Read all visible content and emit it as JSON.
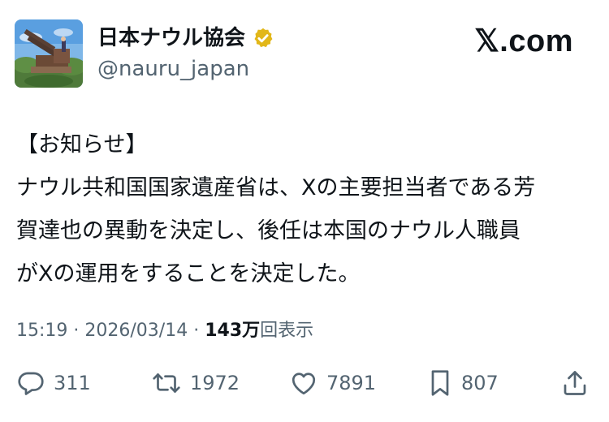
{
  "account": {
    "display_name": "日本ナウル協会",
    "handle": "@nauru_japan",
    "verified_icon": "verified-badge-icon",
    "verified_color": "#e2b719"
  },
  "brand": {
    "label": "𝕏.com"
  },
  "post": {
    "lines": [
      "【お知らせ】",
      "ナウル共和国国家遺産省は、Xの主要担当者である芳",
      "賀達也の異動を決定し、後任は本国のナウル人職員",
      "がXの運用をすることを決定した。"
    ]
  },
  "meta": {
    "time": "15:19",
    "separator": "·",
    "date": "2026/03/14",
    "views_count": "143万",
    "views_label": "回表示"
  },
  "actions": {
    "replies": {
      "icon": "reply-icon",
      "count": "311"
    },
    "reposts": {
      "icon": "repost-icon",
      "count": "1972"
    },
    "likes": {
      "icon": "heart-icon",
      "count": "7891"
    },
    "bookmarks": {
      "icon": "bookmark-icon",
      "count": "807"
    },
    "share": {
      "icon": "share-icon"
    }
  },
  "colors": {
    "text_primary": "#0f1419",
    "text_secondary": "#536471"
  }
}
